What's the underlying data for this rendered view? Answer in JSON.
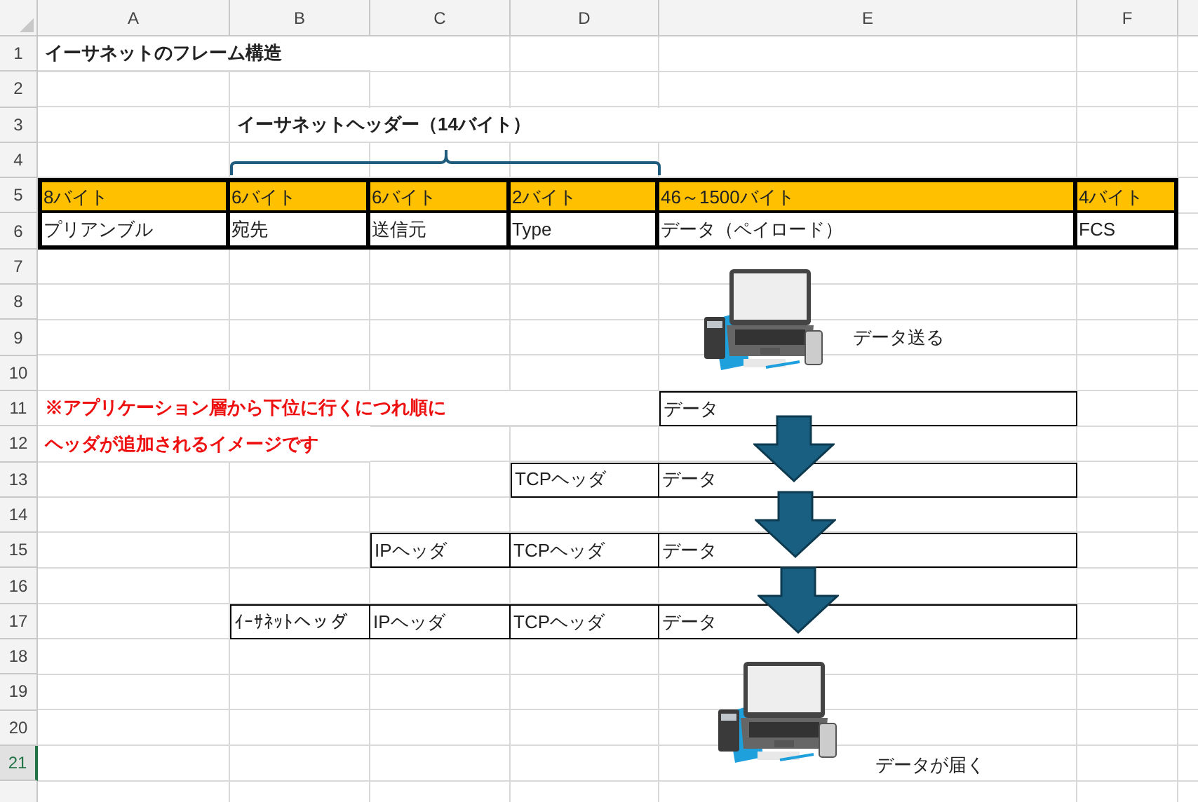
{
  "sheet": {
    "columns": [
      "A",
      "B",
      "C",
      "D",
      "E",
      "F"
    ],
    "rows": [
      {
        "label": "1",
        "selected": false
      },
      {
        "label": "2",
        "selected": false
      },
      {
        "label": "3",
        "selected": false
      },
      {
        "label": "4",
        "selected": false
      },
      {
        "label": "5",
        "selected": false
      },
      {
        "label": "6",
        "selected": false
      },
      {
        "label": "7",
        "selected": false
      },
      {
        "label": "8",
        "selected": false
      },
      {
        "label": "9",
        "selected": false
      },
      {
        "label": "10",
        "selected": false
      },
      {
        "label": "11",
        "selected": false
      },
      {
        "label": "12",
        "selected": false
      },
      {
        "label": "13",
        "selected": false
      },
      {
        "label": "14",
        "selected": false
      },
      {
        "label": "15",
        "selected": false
      },
      {
        "label": "16",
        "selected": false
      },
      {
        "label": "17",
        "selected": false
      },
      {
        "label": "18",
        "selected": false
      },
      {
        "label": "19",
        "selected": false
      },
      {
        "label": "20",
        "selected": false
      },
      {
        "label": "21",
        "selected": true
      }
    ]
  },
  "title": "イーサネットのフレーム構造",
  "header_label": "イーサネットヘッダー（14バイト）",
  "frame": {
    "sizes": [
      "8バイト",
      "6バイト",
      "6バイト",
      "2バイト",
      "46～1500バイト",
      "4バイト"
    ],
    "fields": [
      "プリアンブル",
      "宛先",
      "送信元",
      "Type",
      "データ（ペイロード）",
      "FCS"
    ]
  },
  "sender_label": "データ送る",
  "note": [
    "※アプリケーション層から下位に行くにつれ順に",
    "ヘッダが追加されるイメージです"
  ],
  "layers": [
    [
      "データ"
    ],
    [
      "TCPヘッダ",
      "データ"
    ],
    [
      "IPヘッダ",
      "TCPヘッダ",
      "データ"
    ],
    [
      "ｲｰｻﾈｯﾄヘッダ",
      "IPヘッダ",
      "TCPヘッダ",
      "データ"
    ]
  ],
  "receiver_label": "データが届く"
}
